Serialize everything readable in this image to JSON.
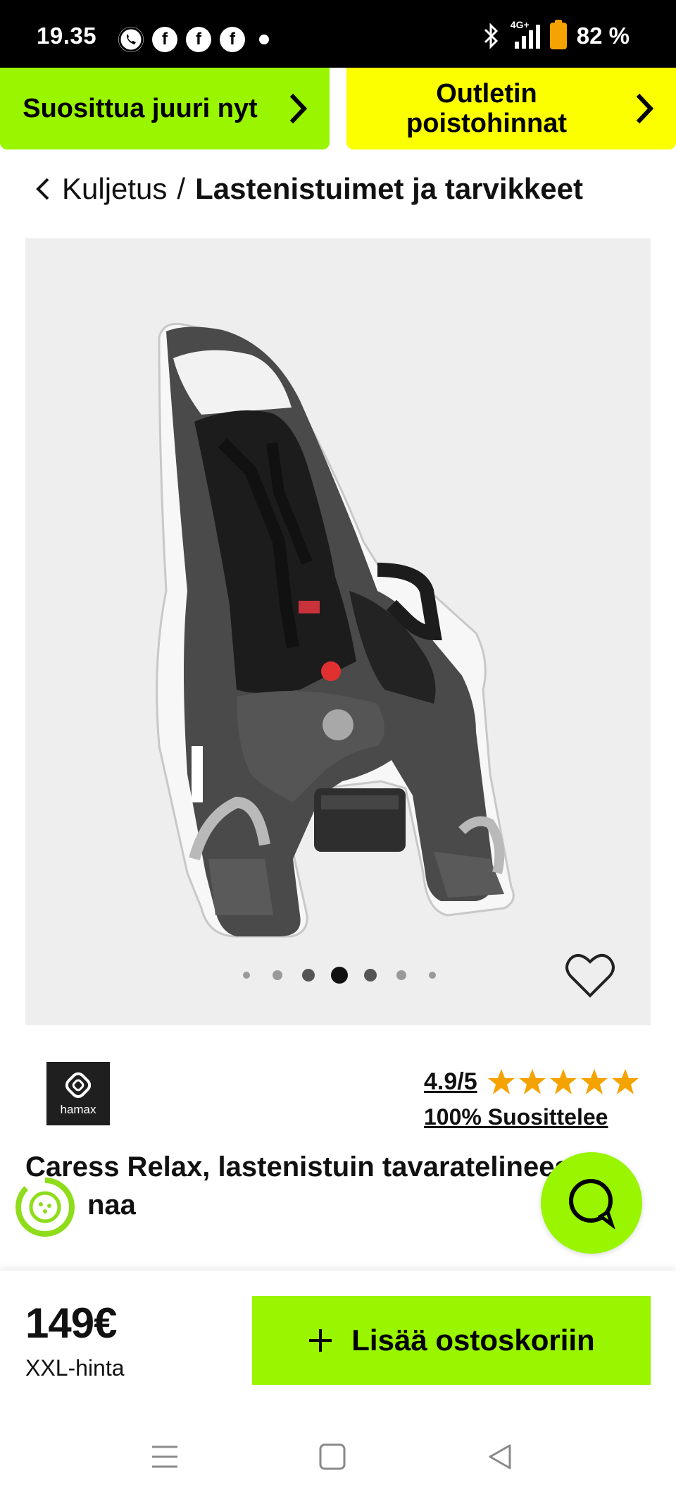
{
  "status_bar": {
    "time": "19.35",
    "battery": "82 %",
    "network": "4G+",
    "icons": [
      "whatsapp-icon",
      "facebook-icon",
      "facebook-icon",
      "facebook-icon",
      "dot-icon",
      "bluetooth-icon",
      "signal-icon",
      "battery-icon"
    ]
  },
  "promos": [
    {
      "label": "Suosittua juuri nyt",
      "color": "#99f500"
    },
    {
      "label": "Outletin poistohinnat",
      "color": "#fbff00"
    }
  ],
  "breadcrumb": {
    "parent": "Kuljetus",
    "separator": "/",
    "current": "Lastenistuimet ja tarvikkeet"
  },
  "gallery": {
    "dot_count": 7,
    "active_index": 3
  },
  "brand": {
    "name": "hamax"
  },
  "rating": {
    "score": "4.9/5",
    "stars": 5,
    "recommend": "100% Suosittelee",
    "star_color": "#f5a300"
  },
  "product": {
    "title_line1": "Caress Relax, lastenistuin tavaratelineeseen",
    "title_line2": "naa"
  },
  "buy": {
    "price": "149€",
    "price_label": "XXL-hinta",
    "add_to_cart": "Lisää ostoskoriin",
    "accent": "#99f500"
  },
  "nav": [
    "menu-icon",
    "home-icon",
    "back-icon"
  ]
}
